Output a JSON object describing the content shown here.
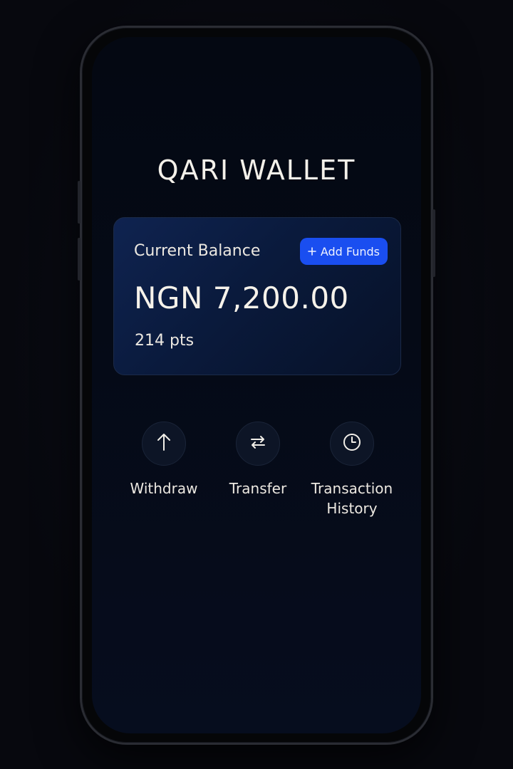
{
  "app": {
    "title": "QARI WALLET"
  },
  "balance_card": {
    "label": "Current Balance",
    "add_funds_label": "Add Funds",
    "add_funds_icon": "plus-icon",
    "amount": "NGN 7,200.00",
    "points": "214 pts"
  },
  "actions": [
    {
      "label": "Withdraw",
      "icon": "arrow-up-icon"
    },
    {
      "label": "Transfer",
      "icon": "transfer-arrows-icon"
    },
    {
      "label": "Transaction History",
      "icon": "clock-icon"
    }
  ],
  "colors": {
    "background": "#07080e",
    "screen": "#050a16",
    "card": "#0f2350",
    "accent": "#1a4ef0",
    "text": "#f4f1ea"
  }
}
